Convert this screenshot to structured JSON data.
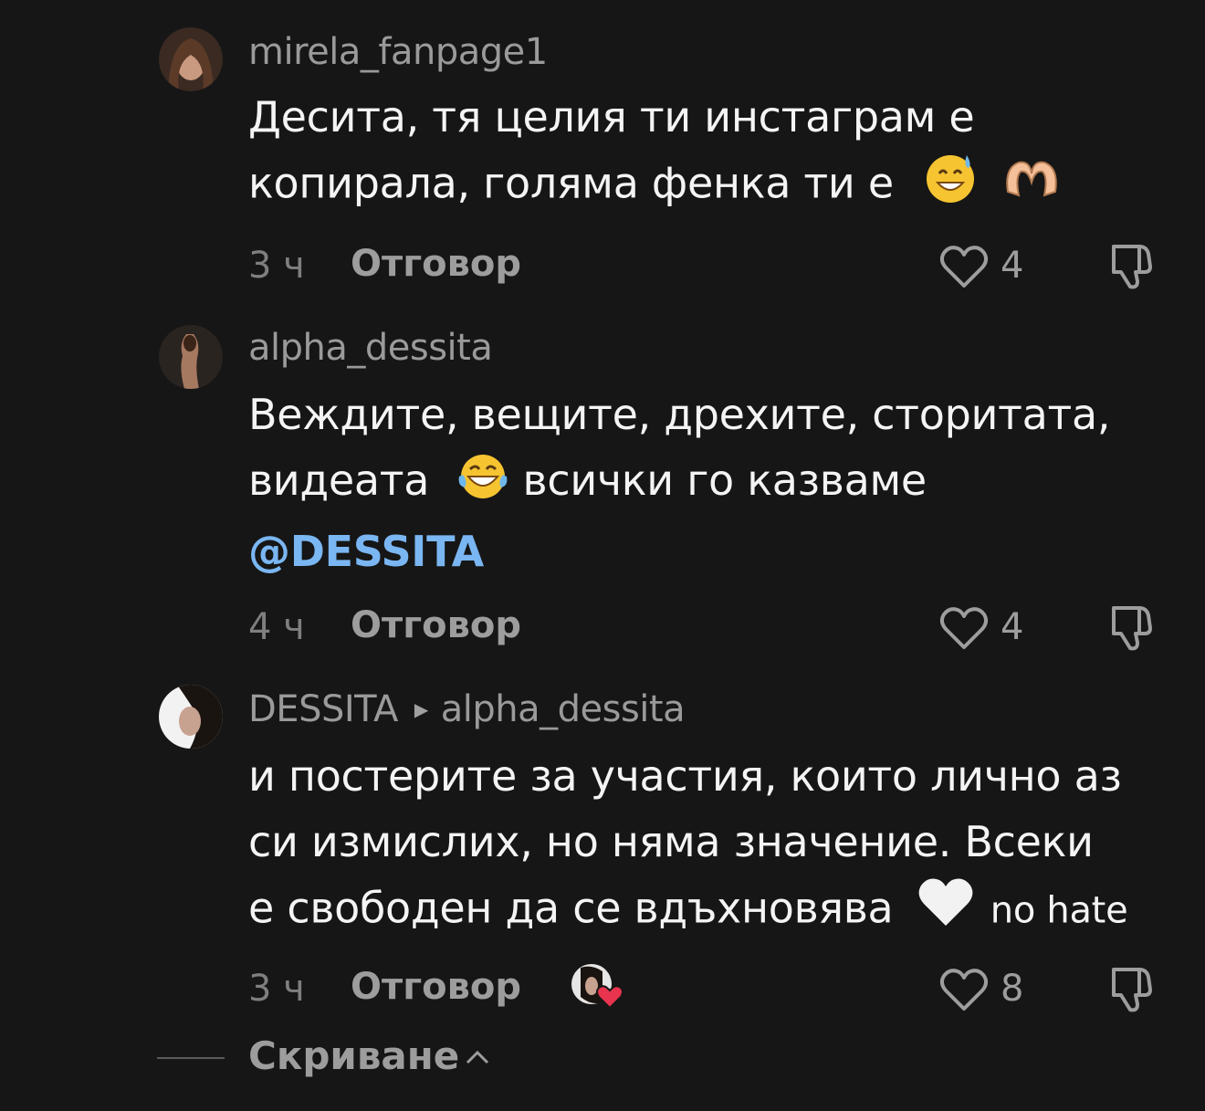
{
  "comments": [
    {
      "username": "mirela_fanpage1",
      "lines": [
        "Десита, тя целия ти инстаграм е",
        "копирала, голяма фенка ти е"
      ],
      "emojis": [
        "grinning-sweat-emoji",
        "heart-hands-emoji"
      ],
      "time": "3 ч",
      "reply_label": "Отговор",
      "likes": "4"
    },
    {
      "username": "alpha_dessita",
      "lines": [
        "Веждите, вещите, дрехите, сторитата,",
        "видеата",
        "всички го казваме"
      ],
      "mention": "@DESSITA",
      "emojis": [
        "laughing-tears-emoji"
      ],
      "time": "4 ч",
      "reply_label": "Отговор",
      "likes": "4"
    },
    {
      "username": "DESSITA",
      "reply_to": "alpha_dessita",
      "lines": [
        "и постерите за участия, които лично аз",
        "си измислих, но няма значение. Всеки",
        "е свободен да се вдъхновява",
        "no hate"
      ],
      "emojis": [
        "white-heart-emoji"
      ],
      "time": "3 ч",
      "reply_label": "Отговор",
      "likes": "8",
      "creator_liked": true
    }
  ],
  "hide_label": "Скриване",
  "colors": {
    "background": "#161616",
    "mention": "#7ab6f2",
    "heart_badge": "#e8344e"
  }
}
